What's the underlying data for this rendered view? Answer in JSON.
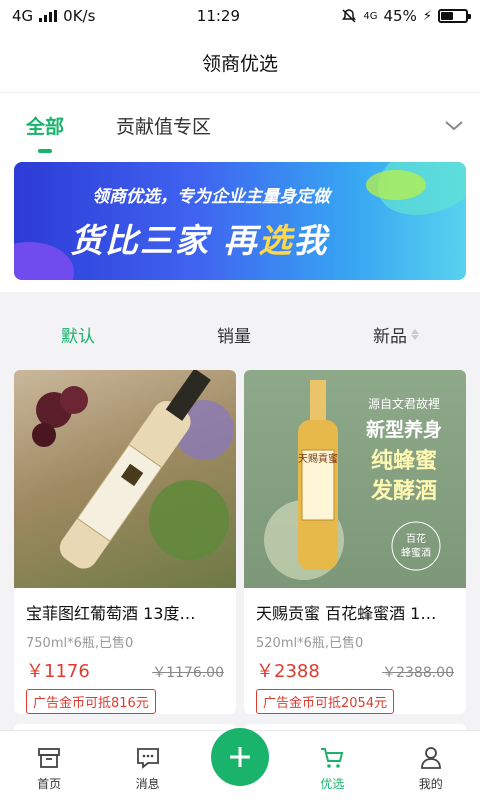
{
  "status_bar": {
    "network": "4G",
    "speed": "0K/s",
    "time": "11:29",
    "network_right": "4G",
    "battery": "45%",
    "battery_level": 0.45
  },
  "header": {
    "title": "领商优选"
  },
  "tabs": [
    {
      "label": "全部",
      "active": true
    },
    {
      "label": "贡献值专区",
      "active": false
    }
  ],
  "banner": {
    "subtitle": "领商优选，专为企业主量身定做",
    "headline_part1": "货比三家 再",
    "headline_highlight": "选",
    "headline_part2": "我"
  },
  "sort": {
    "default": "默认",
    "sales": "销量",
    "new": "新品"
  },
  "products": [
    {
      "title": "宝菲图红葡萄酒 13度…",
      "meta": "750ml*6瓶,已售0",
      "price": "￥1176",
      "old_price": "￥1176.00",
      "coin": "广告金币可抵816元"
    },
    {
      "title": "天赐贡蜜 百花蜂蜜酒 1…",
      "meta": "520ml*6瓶,已售0",
      "price": "￥2388",
      "old_price": "￥2388.00",
      "coin": "广告金币可抵2054元",
      "image_text": {
        "top": "源自文君故裡",
        "line1": "新型养身",
        "line2": "纯蜂蜜",
        "line3": "发酵酒",
        "bottle": "天赐貢蜜",
        "badge1": "百花",
        "badge2": "蜂蜜酒"
      }
    }
  ],
  "bottom_nav": {
    "home": "首页",
    "messages": "消息",
    "featured": "优选",
    "mine": "我的"
  },
  "colors": {
    "accent": "#1ab36b",
    "price": "#e03b2f"
  }
}
